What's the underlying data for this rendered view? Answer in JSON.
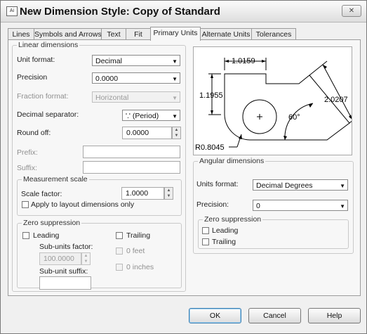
{
  "window": {
    "title": "New Dimension Style: Copy of Standard",
    "app_icon_text": "Ai",
    "close_glyph": "✕"
  },
  "tabs": [
    "Lines",
    "Symbols and Arrows",
    "Text",
    "Fit",
    "Primary Units",
    "Alternate Units",
    "Tolerances"
  ],
  "active_tab": "Primary Units",
  "linear": {
    "title": "Linear dimensions",
    "unit_format_label": "Unit format:",
    "unit_format_value": "Decimal",
    "precision_label": "Precision",
    "precision_value": "0.0000",
    "fraction_format_label": "Fraction format:",
    "fraction_format_value": "Horizontal",
    "decimal_separator_label": "Decimal separator:",
    "decimal_separator_value": "'.' (Period)",
    "round_off_label": "Round off:",
    "round_off_value": "0.0000",
    "prefix_label": "Prefix:",
    "prefix_value": "",
    "suffix_label": "Suffix:",
    "suffix_value": ""
  },
  "measurement_scale": {
    "title": "Measurement scale",
    "scale_factor_label": "Scale factor:",
    "scale_factor_value": "1.0000",
    "apply_layout_label": "Apply to layout dimensions only",
    "apply_layout_checked": false
  },
  "zero_suppression_linear": {
    "title": "Zero suppression",
    "leading_label": "Leading",
    "trailing_label": "Trailing",
    "subunits_factor_label": "Sub-units factor:",
    "subunits_factor_value": "100.0000",
    "zero_feet_label": "0 feet",
    "zero_inches_label": "0 inches",
    "subunit_suffix_label": "Sub-unit suffix:",
    "subunit_suffix_value": ""
  },
  "preview": {
    "dim_top": "1.0159",
    "dim_left": "1.1955",
    "dim_right": "2.0207",
    "angle": "60°",
    "radius": "R0.8045"
  },
  "angular": {
    "title": "Angular dimensions",
    "units_format_label": "Units format:",
    "units_format_value": "Decimal Degrees",
    "precision_label": "Precision:",
    "precision_value": "0"
  },
  "zero_suppression_angular": {
    "title": "Zero suppression",
    "leading_label": "Leading",
    "trailing_label": "Trailing"
  },
  "buttons": {
    "ok": "OK",
    "cancel": "Cancel",
    "help": "Help"
  }
}
